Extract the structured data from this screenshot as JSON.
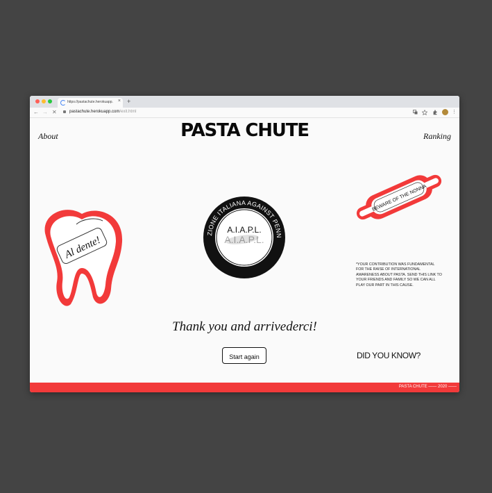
{
  "browser": {
    "tab_title": "https://pastachute.herokuapp.",
    "tab_close": "×",
    "new_tab": "+",
    "url_host": "pastachute.herokuapp.com",
    "url_path": "/exit.html",
    "back": "←",
    "forward": "→",
    "reload": "✕",
    "menu": "⋮"
  },
  "nav": {
    "about": "About",
    "ranking": "Ranking"
  },
  "site_title": "PASTA CHUTE",
  "tooth_sticker": {
    "label": "Al dente!"
  },
  "seal": {
    "ring_text": "ASSOCIAZIONE ITALIANA AGAINST PENNA LISCIA",
    "acronym": "A.I.A.P.L."
  },
  "pin_sticker": {
    "label": "BEWARE OF THE NONNA"
  },
  "contribution_text": "*YOUR CONTRIBUTION WAS FUNDAMENTAL FOR THE RAISE OF INTERNATIONAL AWARENESS ABOUT PASTA. SEND THIS LINK TO YOUR FRIENDS AND FAMILY SO WE CAN ALL PLAY OUR PART IN THIS CAUSE.",
  "thanks_text": "Thank you and arrivederci!",
  "start_button": "Start again",
  "did_you_know": "DID YOU KNOW?",
  "footer_text": "PASTA CHUTE —— 2020 ——",
  "colors": {
    "accent": "#f23a3a",
    "ink": "#111111",
    "backdrop": "#444444",
    "page": "#fafafa"
  }
}
